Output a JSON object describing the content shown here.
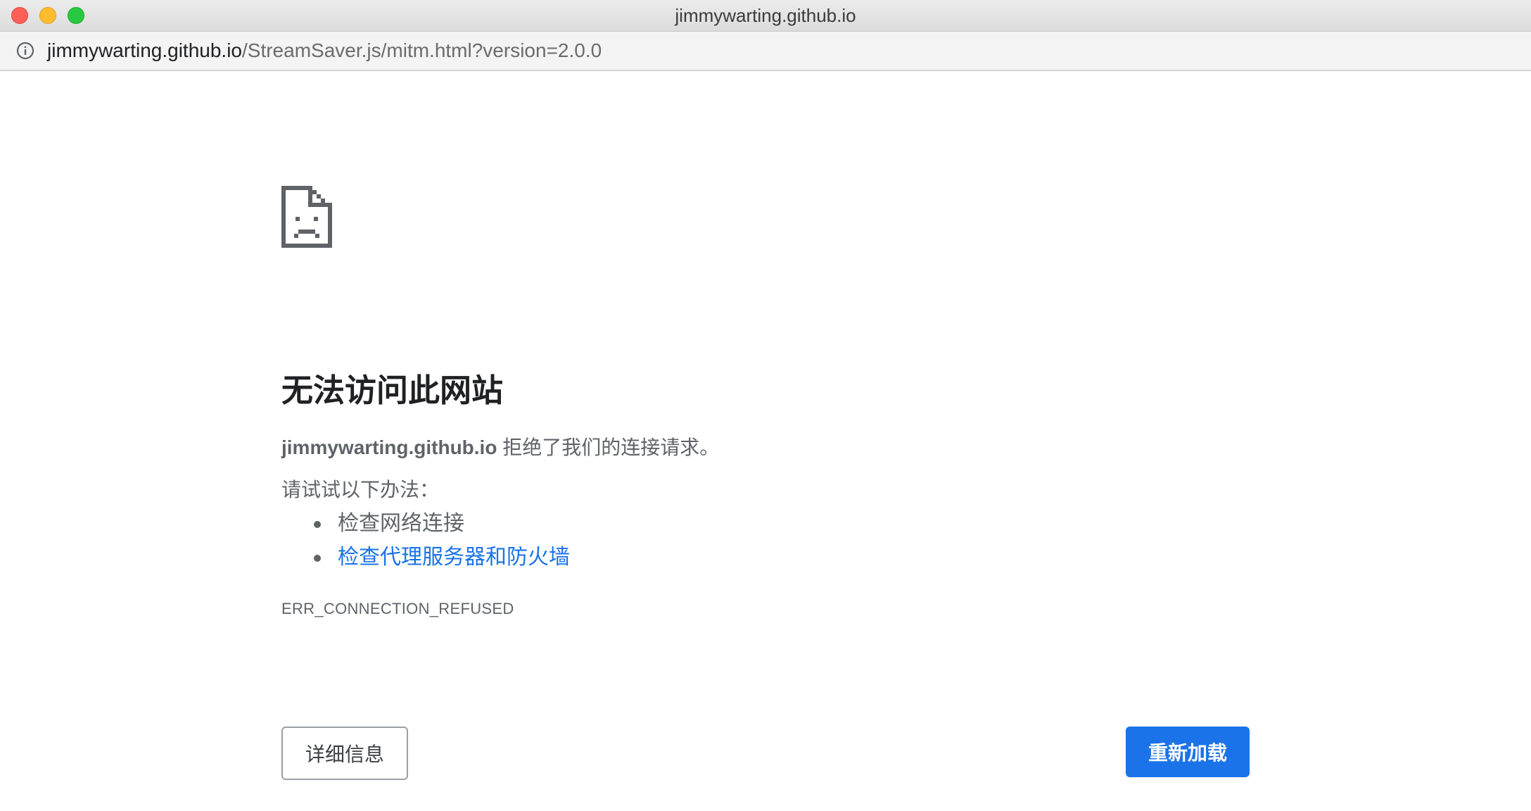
{
  "window": {
    "title": "jimmywarting.github.io"
  },
  "urlbar": {
    "icon": "info-icon",
    "host": "jimmywarting.github.io",
    "path": "/StreamSaver.js/mitm.html?version=2.0.0"
  },
  "error_page": {
    "icon": "sad-page-icon",
    "heading": "无法访问此网站",
    "summary_host": "jimmywarting.github.io",
    "summary_text": " 拒绝了我们的连接请求。",
    "try_label": "请试试以下办法：",
    "suggestions": [
      {
        "label": "检查网络连接",
        "is_link": false
      },
      {
        "label": "检查代理服务器和防火墙",
        "is_link": true
      }
    ],
    "error_code": "ERR_CONNECTION_REFUSED",
    "details_button": "详细信息",
    "reload_button": "重新加载"
  },
  "colors": {
    "link": "#1a73e8",
    "primary_button": "#1a73e8",
    "text_secondary": "#5f6368",
    "close": "#fe5f57",
    "minimize": "#febc2e",
    "maximize": "#28c840"
  }
}
